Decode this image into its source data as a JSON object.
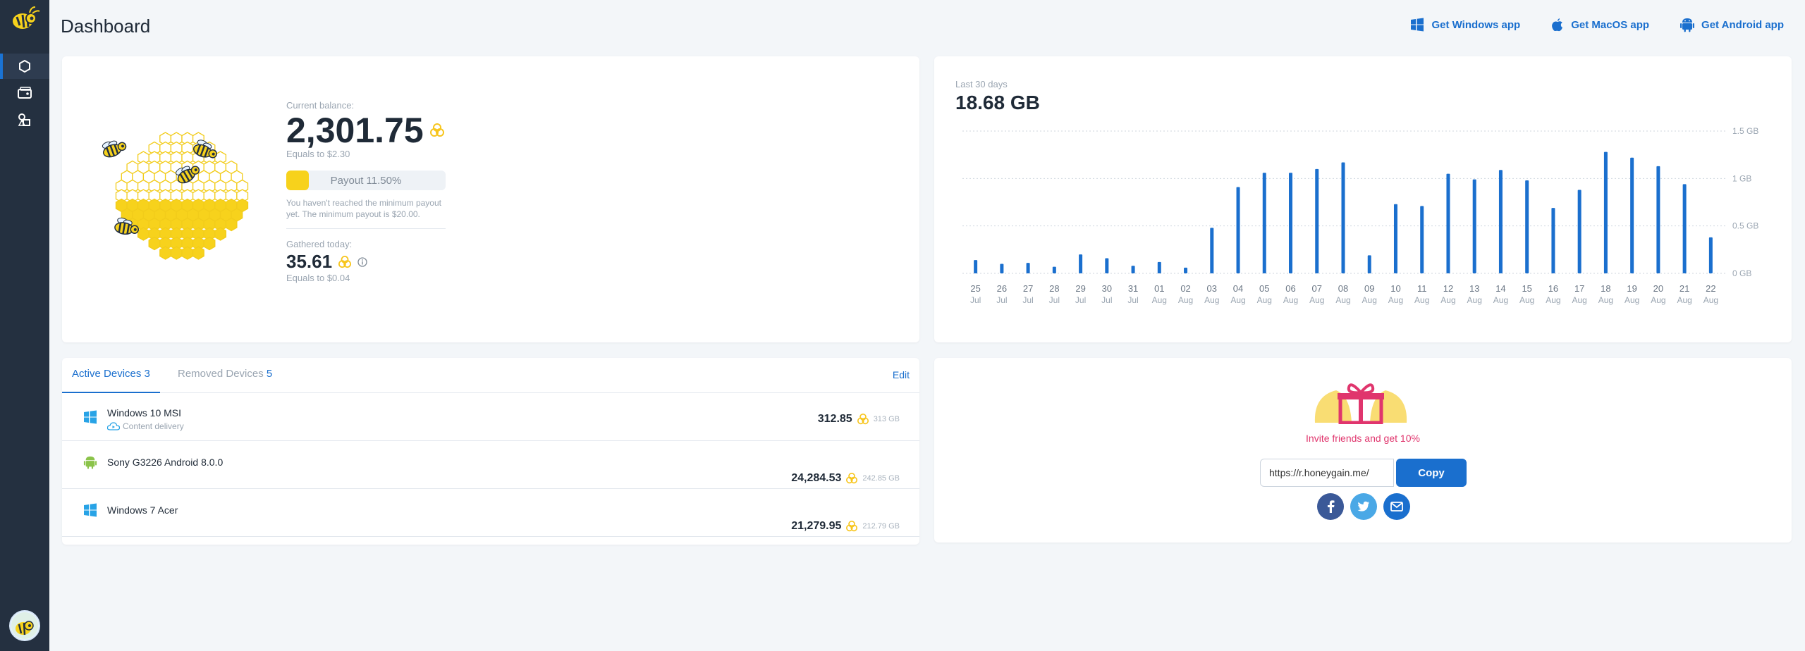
{
  "header": {
    "title": "Dashboard",
    "apps": [
      {
        "label": "Get Windows app",
        "icon": "windows-icon"
      },
      {
        "label": "Get MacOS app",
        "icon": "apple-icon"
      },
      {
        "label": "Get Android app",
        "icon": "android-icon"
      }
    ]
  },
  "sidebar": {
    "items": [
      {
        "icon": "hexagon-icon",
        "active": true
      },
      {
        "icon": "wallet-icon",
        "active": false
      },
      {
        "icon": "shapes-icon",
        "active": false
      }
    ]
  },
  "balance": {
    "current_label": "Current balance:",
    "current_value": "2,301.75",
    "current_equals": "Equals to $2.30",
    "payout_label": "Payout 11.50%",
    "payout_fraction": 0.115,
    "payout_note": "You haven't reached the minimum payout yet. The minimum payout is $20.00.",
    "gathered_label": "Gathered today:",
    "gathered_value": "35.61",
    "gathered_equals": "Equals to $0.04"
  },
  "traffic": {
    "label": "Last 30 days",
    "total": "18.68 GB"
  },
  "chart_data": {
    "type": "bar",
    "categories": [
      "25 Jul",
      "26 Jul",
      "27 Jul",
      "28 Jul",
      "29 Jul",
      "30 Jul",
      "31 Jul",
      "01 Aug",
      "02 Aug",
      "03 Aug",
      "04 Aug",
      "05 Aug",
      "06 Aug",
      "07 Aug",
      "08 Aug",
      "09 Aug",
      "10 Aug",
      "11 Aug",
      "12 Aug",
      "13 Aug",
      "14 Aug",
      "15 Aug",
      "16 Aug",
      "17 Aug",
      "18 Aug",
      "19 Aug",
      "20 Aug",
      "21 Aug",
      "22 Aug"
    ],
    "x_day": [
      "25",
      "26",
      "27",
      "28",
      "29",
      "30",
      "31",
      "01",
      "02",
      "03",
      "04",
      "05",
      "06",
      "07",
      "08",
      "09",
      "10",
      "11",
      "12",
      "13",
      "14",
      "15",
      "16",
      "17",
      "18",
      "19",
      "20",
      "21",
      "22"
    ],
    "x_month": [
      "Jul",
      "Jul",
      "Jul",
      "Jul",
      "Jul",
      "Jul",
      "Jul",
      "Aug",
      "Aug",
      "Aug",
      "Aug",
      "Aug",
      "Aug",
      "Aug",
      "Aug",
      "Aug",
      "Aug",
      "Aug",
      "Aug",
      "Aug",
      "Aug",
      "Aug",
      "Aug",
      "Aug",
      "Aug",
      "Aug",
      "Aug",
      "Aug",
      "Aug"
    ],
    "values": [
      0.14,
      0.1,
      0.11,
      0.07,
      0.2,
      0.16,
      0.08,
      0.12,
      0.06,
      0.48,
      0.91,
      1.06,
      1.06,
      1.1,
      1.17,
      0.19,
      0.73,
      0.71,
      1.05,
      0.99,
      1.09,
      0.98,
      0.69,
      0.88,
      1.28,
      1.22,
      1.13,
      0.94,
      0.38
    ],
    "yticks": [
      {
        "value": 0,
        "label": "0 GB"
      },
      {
        "value": 0.5,
        "label": "0.5 GB"
      },
      {
        "value": 1,
        "label": "1 GB"
      },
      {
        "value": 1.5,
        "label": "1.5 GB"
      }
    ],
    "ylim": [
      0,
      1.5
    ],
    "grid": true,
    "bar_color": "#1a6fce"
  },
  "devices": {
    "tab_active_label": "Active Devices",
    "tab_active_count": "3",
    "tab_removed_label": "Removed Devices",
    "tab_removed_count": "5",
    "edit_label": "Edit",
    "rows": [
      {
        "name": "Windows 10 MSI",
        "sub": "Content delivery",
        "value": "312.85",
        "gb": "313 GB",
        "icon": "windows-icon"
      },
      {
        "name": "Sony G3226 Android 8.0.0",
        "sub": "",
        "value": "24,284.53",
        "gb": "242.85 GB",
        "icon": "android-icon"
      },
      {
        "name": "Windows 7 Acer",
        "sub": "",
        "value": "21,279.95",
        "gb": "212.79 GB",
        "icon": "windows-icon"
      }
    ]
  },
  "invite": {
    "text": "Invite friends and get 10%",
    "link": "https://r.honeygain.me/",
    "copy_label": "Copy",
    "social": [
      "facebook-icon",
      "twitter-icon",
      "email-icon"
    ]
  },
  "colors": {
    "accent": "#1a6fce",
    "honey": "#f7d21c",
    "sidebar": "#243040",
    "invite": "#e0356d"
  }
}
